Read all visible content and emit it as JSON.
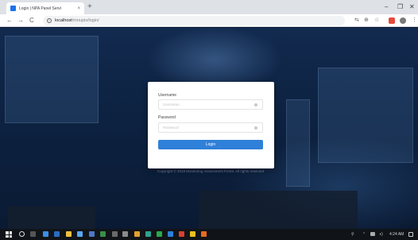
{
  "browser": {
    "tab_title": "Login | NPA Panel Servi",
    "tab_close": "×",
    "new_tab": "+",
    "window_controls": {
      "minimize": "–",
      "maximize": "❐",
      "close": "✕"
    },
    "nav": {
      "back": "←",
      "forward": "→",
      "reload": "C"
    },
    "url_info": "i",
    "url_host": "localhost",
    "url_path": "/mnupis/login/",
    "toolbar_icons": {
      "translate": "⇆",
      "zoom": "⊕",
      "star": "☆",
      "menu": "⋮"
    }
  },
  "login": {
    "username_label": "Username",
    "username_placeholder": "Username",
    "password_label": "Password",
    "password_placeholder": "Password",
    "login_button": "Login",
    "copyright": "Copyright © 2019 Monitoring Assessment Portal. All rights reserved"
  },
  "taskbar": {
    "clock": "4:24 AM",
    "tray_icons": {
      "people": "⚲",
      "chevron": "⌃",
      "volume": "◖)"
    }
  },
  "colors": {
    "accent": "#2f80d8",
    "tab_bg": "#dee1e6",
    "page_bg": "#0d2241",
    "taskbar_bg": "#101418"
  }
}
